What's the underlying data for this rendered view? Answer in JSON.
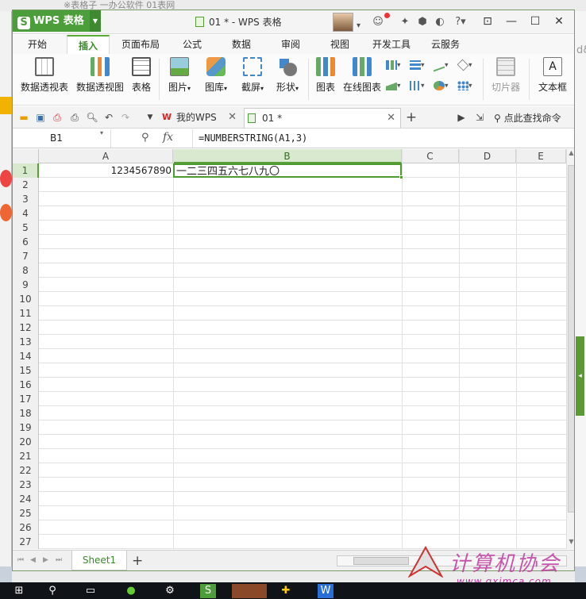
{
  "window": {
    "app_name": "WPS 表格",
    "app_logo": "S",
    "doc_title": "01 * - WPS 表格",
    "controls": [
      "—",
      "☐",
      "✕"
    ]
  },
  "background": {
    "top_text": "※表格子 一办公软件  01表网",
    "right_text": "d&"
  },
  "menu": {
    "items": [
      "开始",
      "插入",
      "页面布局",
      "公式",
      "数据",
      "审阅",
      "视图",
      "开发工具",
      "云服务"
    ],
    "active": "插入"
  },
  "ribbon": {
    "pivot_table": "数据透视表",
    "pivot_chart": "数据透视图",
    "table": "表格",
    "picture": "图片",
    "gallery": "图库",
    "screenshot": "截屏",
    "shapes": "形状",
    "chart": "图表",
    "online_chart": "在线图表",
    "slicer": "切片器",
    "textbox": "文本框"
  },
  "tabs": [
    {
      "label": "我的WPS",
      "icon": "wps-icon",
      "active": false
    },
    {
      "label": "01 *",
      "icon": "sheet-doc-icon",
      "active": true
    }
  ],
  "quick_search": "点此查找命令",
  "formula_bar": {
    "name_box": "B1",
    "fx": "fx",
    "formula": "=NUMBERSTRING(A1,3)"
  },
  "grid": {
    "columns": [
      "A",
      "B",
      "C",
      "D",
      "E"
    ],
    "selected_column": "B",
    "row_count": 27,
    "selected_row": 1,
    "cells": {
      "A1": "1234567890",
      "B1": "一二三四五六七八九〇"
    }
  },
  "sheets": [
    "Sheet1"
  ],
  "watermark": {
    "text": "计算机协会",
    "url": "www.gxjmca.com"
  },
  "colors": {
    "accent": "#4c9e3a",
    "selection": "#4e9a32",
    "watermark": "#c03aa0"
  }
}
